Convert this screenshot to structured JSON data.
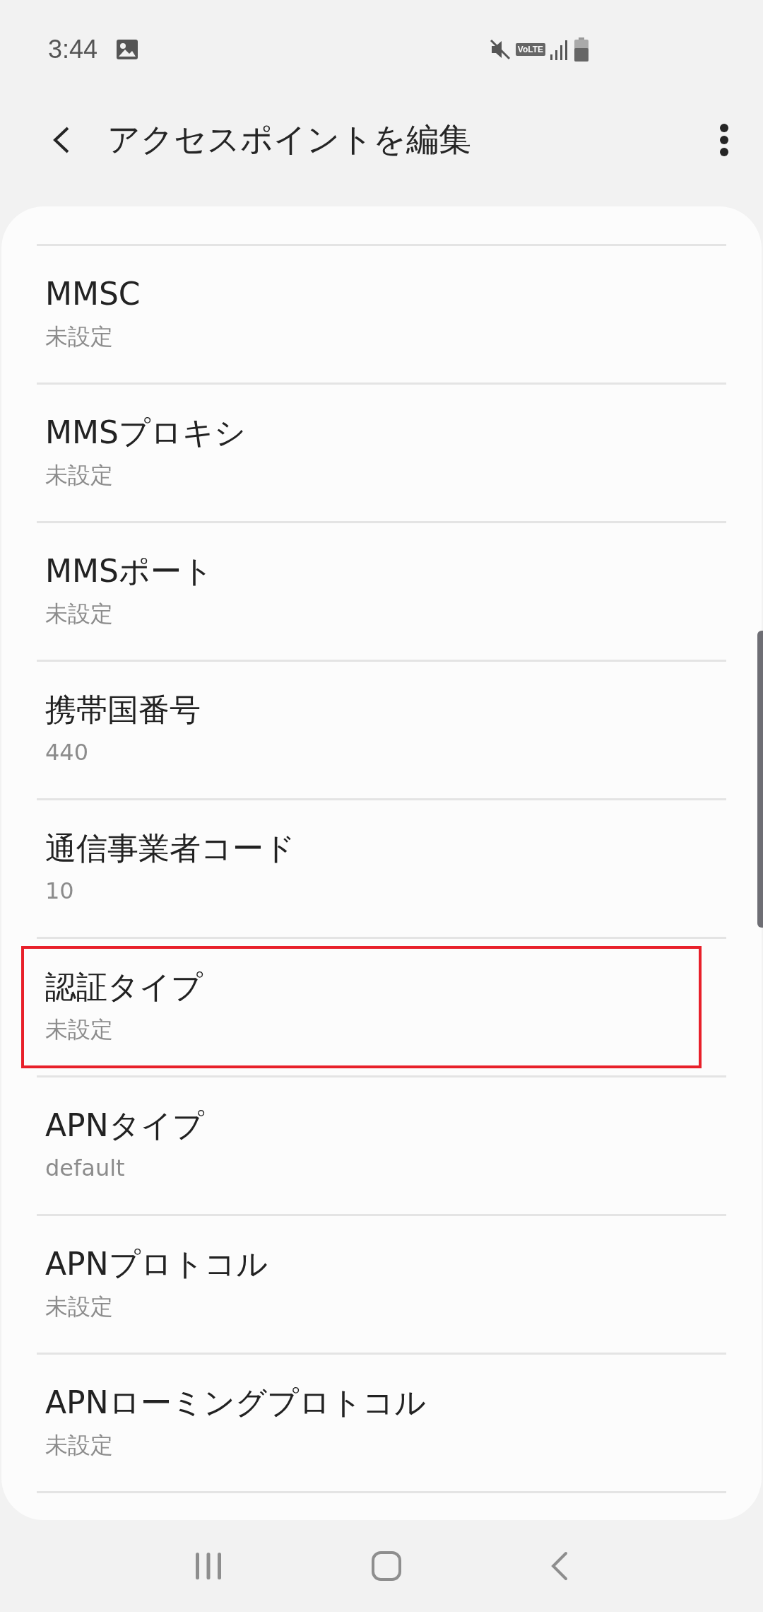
{
  "status_bar": {
    "time": "3:44",
    "volte": "VoLTE"
  },
  "header": {
    "title": "アクセスポイントを編集"
  },
  "settings": [
    {
      "title": "MMSC",
      "value": "未設定",
      "highlighted": false
    },
    {
      "title": "MMSプロキシ",
      "value": "未設定",
      "highlighted": false
    },
    {
      "title": "MMSポート",
      "value": "未設定",
      "highlighted": false
    },
    {
      "title": "携帯国番号",
      "value": "440",
      "highlighted": false
    },
    {
      "title": "通信事業者コード",
      "value": "10",
      "highlighted": false
    },
    {
      "title": "認証タイプ",
      "value": "未設定",
      "highlighted": true
    },
    {
      "title": "APNタイプ",
      "value": "default",
      "highlighted": false
    },
    {
      "title": "APNプロトコル",
      "value": "未設定",
      "highlighted": false
    },
    {
      "title": "APNローミングプロトコル",
      "value": "未設定",
      "highlighted": false
    }
  ]
}
